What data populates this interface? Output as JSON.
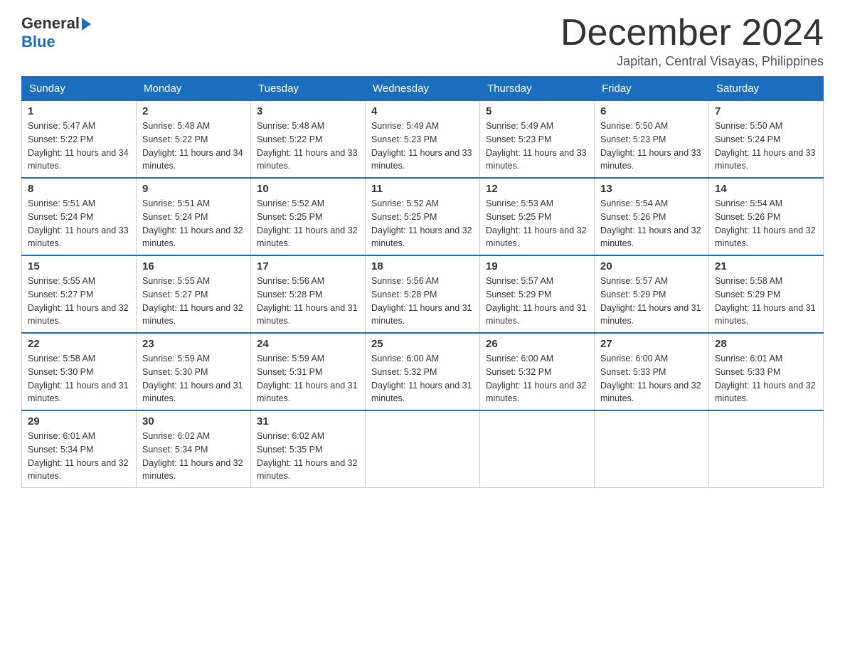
{
  "logo": {
    "general": "General",
    "blue": "Blue",
    "arrow": "▶"
  },
  "title": {
    "month_year": "December 2024",
    "location": "Japitan, Central Visayas, Philippines"
  },
  "weekdays": [
    "Sunday",
    "Monday",
    "Tuesday",
    "Wednesday",
    "Thursday",
    "Friday",
    "Saturday"
  ],
  "weeks": [
    [
      {
        "num": "1",
        "sunrise": "5:47 AM",
        "sunset": "5:22 PM",
        "daylight": "11 hours and 34 minutes."
      },
      {
        "num": "2",
        "sunrise": "5:48 AM",
        "sunset": "5:22 PM",
        "daylight": "11 hours and 34 minutes."
      },
      {
        "num": "3",
        "sunrise": "5:48 AM",
        "sunset": "5:22 PM",
        "daylight": "11 hours and 33 minutes."
      },
      {
        "num": "4",
        "sunrise": "5:49 AM",
        "sunset": "5:23 PM",
        "daylight": "11 hours and 33 minutes."
      },
      {
        "num": "5",
        "sunrise": "5:49 AM",
        "sunset": "5:23 PM",
        "daylight": "11 hours and 33 minutes."
      },
      {
        "num": "6",
        "sunrise": "5:50 AM",
        "sunset": "5:23 PM",
        "daylight": "11 hours and 33 minutes."
      },
      {
        "num": "7",
        "sunrise": "5:50 AM",
        "sunset": "5:24 PM",
        "daylight": "11 hours and 33 minutes."
      }
    ],
    [
      {
        "num": "8",
        "sunrise": "5:51 AM",
        "sunset": "5:24 PM",
        "daylight": "11 hours and 33 minutes."
      },
      {
        "num": "9",
        "sunrise": "5:51 AM",
        "sunset": "5:24 PM",
        "daylight": "11 hours and 32 minutes."
      },
      {
        "num": "10",
        "sunrise": "5:52 AM",
        "sunset": "5:25 PM",
        "daylight": "11 hours and 32 minutes."
      },
      {
        "num": "11",
        "sunrise": "5:52 AM",
        "sunset": "5:25 PM",
        "daylight": "11 hours and 32 minutes."
      },
      {
        "num": "12",
        "sunrise": "5:53 AM",
        "sunset": "5:25 PM",
        "daylight": "11 hours and 32 minutes."
      },
      {
        "num": "13",
        "sunrise": "5:54 AM",
        "sunset": "5:26 PM",
        "daylight": "11 hours and 32 minutes."
      },
      {
        "num": "14",
        "sunrise": "5:54 AM",
        "sunset": "5:26 PM",
        "daylight": "11 hours and 32 minutes."
      }
    ],
    [
      {
        "num": "15",
        "sunrise": "5:55 AM",
        "sunset": "5:27 PM",
        "daylight": "11 hours and 32 minutes."
      },
      {
        "num": "16",
        "sunrise": "5:55 AM",
        "sunset": "5:27 PM",
        "daylight": "11 hours and 32 minutes."
      },
      {
        "num": "17",
        "sunrise": "5:56 AM",
        "sunset": "5:28 PM",
        "daylight": "11 hours and 31 minutes."
      },
      {
        "num": "18",
        "sunrise": "5:56 AM",
        "sunset": "5:28 PM",
        "daylight": "11 hours and 31 minutes."
      },
      {
        "num": "19",
        "sunrise": "5:57 AM",
        "sunset": "5:29 PM",
        "daylight": "11 hours and 31 minutes."
      },
      {
        "num": "20",
        "sunrise": "5:57 AM",
        "sunset": "5:29 PM",
        "daylight": "11 hours and 31 minutes."
      },
      {
        "num": "21",
        "sunrise": "5:58 AM",
        "sunset": "5:29 PM",
        "daylight": "11 hours and 31 minutes."
      }
    ],
    [
      {
        "num": "22",
        "sunrise": "5:58 AM",
        "sunset": "5:30 PM",
        "daylight": "11 hours and 31 minutes."
      },
      {
        "num": "23",
        "sunrise": "5:59 AM",
        "sunset": "5:30 PM",
        "daylight": "11 hours and 31 minutes."
      },
      {
        "num": "24",
        "sunrise": "5:59 AM",
        "sunset": "5:31 PM",
        "daylight": "11 hours and 31 minutes."
      },
      {
        "num": "25",
        "sunrise": "6:00 AM",
        "sunset": "5:32 PM",
        "daylight": "11 hours and 31 minutes."
      },
      {
        "num": "26",
        "sunrise": "6:00 AM",
        "sunset": "5:32 PM",
        "daylight": "11 hours and 32 minutes."
      },
      {
        "num": "27",
        "sunrise": "6:00 AM",
        "sunset": "5:33 PM",
        "daylight": "11 hours and 32 minutes."
      },
      {
        "num": "28",
        "sunrise": "6:01 AM",
        "sunset": "5:33 PM",
        "daylight": "11 hours and 32 minutes."
      }
    ],
    [
      {
        "num": "29",
        "sunrise": "6:01 AM",
        "sunset": "5:34 PM",
        "daylight": "11 hours and 32 minutes."
      },
      {
        "num": "30",
        "sunrise": "6:02 AM",
        "sunset": "5:34 PM",
        "daylight": "11 hours and 32 minutes."
      },
      {
        "num": "31",
        "sunrise": "6:02 AM",
        "sunset": "5:35 PM",
        "daylight": "11 hours and 32 minutes."
      },
      null,
      null,
      null,
      null
    ]
  ]
}
